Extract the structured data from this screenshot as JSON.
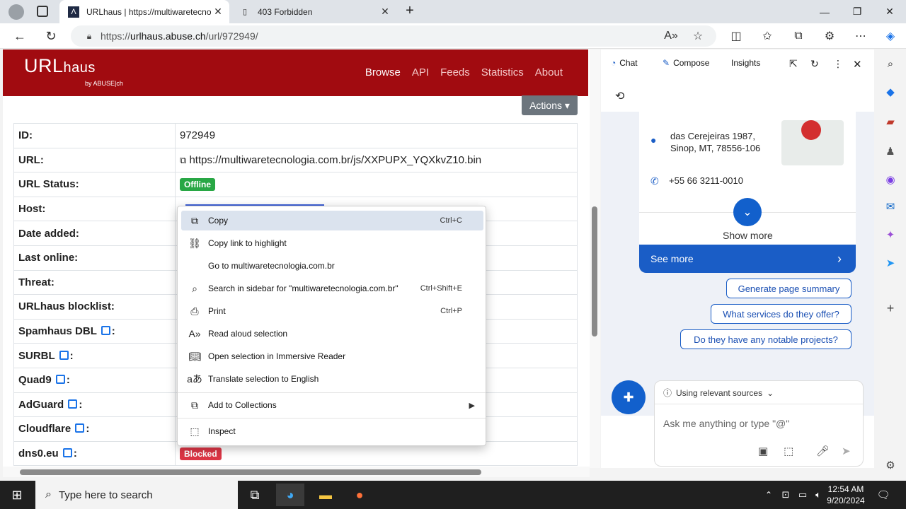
{
  "browser": {
    "tabs": [
      {
        "title": "URLhaus | https://multiwaretecnologia",
        "icon": "urlhaus-favicon"
      },
      {
        "title": "403 Forbidden",
        "icon": "page-icon"
      }
    ],
    "address": {
      "prefix": "https://",
      "domain": "urlhaus.abuse.ch",
      "path": "/url/972949/"
    }
  },
  "site": {
    "logo_main": "URL",
    "logo_sub": "haus",
    "logo_by": "by ABUSE|ch",
    "nav": [
      "Browse",
      "API",
      "Feeds",
      "Statistics",
      "About"
    ],
    "actions_label": "Actions ▾"
  },
  "table": [
    {
      "key": "ID:",
      "value": "972949"
    },
    {
      "key": "URL:",
      "value": "https://multiwaretecnologia.com.br/js/XXPUPX_YQXkvZ10.bin"
    },
    {
      "key": "URL Status:",
      "value": "Offline"
    },
    {
      "key": "Host:",
      "value": ""
    },
    {
      "key": "Date added:",
      "value": ""
    },
    {
      "key": "Last online:",
      "value": ""
    },
    {
      "key": "Threat:",
      "value": ""
    },
    {
      "key": "URLhaus blocklist:",
      "value": ""
    },
    {
      "key": "Spamhaus DBL",
      "value": ""
    },
    {
      "key": "SURBL",
      "value": ""
    },
    {
      "key": "Quad9",
      "value": ""
    },
    {
      "key": "AdGuard",
      "value": ""
    },
    {
      "key": "Cloudflare",
      "value": ""
    },
    {
      "key": "dns0.eu",
      "value": "Blocked"
    }
  ],
  "status_colors": {
    "offline": "#28a745",
    "blocked": "#dc3545",
    "brand": "#a10b10"
  },
  "context_menu": [
    {
      "label": "Copy",
      "shortcut": "Ctrl+C",
      "icon": "copy-icon"
    },
    {
      "label": "Copy link to highlight",
      "shortcut": "",
      "icon": "link-icon"
    },
    {
      "label": "Go to multiwaretecnologia.com.br",
      "shortcut": "",
      "icon": ""
    },
    {
      "label": "Search in sidebar for \"multiwaretecnologia.com.br\"",
      "shortcut": "Ctrl+Shift+E",
      "icon": "sidebar-search-icon"
    },
    {
      "label": "Print",
      "shortcut": "Ctrl+P",
      "icon": "print-icon"
    },
    {
      "label": "Read aloud selection",
      "shortcut": "",
      "icon": "read-aloud-icon"
    },
    {
      "label": "Open selection in Immersive Reader",
      "shortcut": "",
      "icon": "immersive-reader-icon"
    },
    {
      "label": "Translate selection to English",
      "shortcut": "",
      "icon": "translate-icon"
    },
    {
      "label": "Add to Collections",
      "shortcut": "",
      "icon": "collections-icon"
    },
    {
      "label": "Inspect",
      "shortcut": "",
      "icon": "inspect-icon"
    }
  ],
  "sidebar": {
    "tabs": [
      "Chat",
      "Compose",
      "Insights"
    ],
    "address_line1": "das Cerejeiras 1987,",
    "address_line2": "Sinop, MT, 78556-106",
    "phone": "+55 66 3211-0010",
    "show_more": "Show more",
    "see_more": "See more",
    "suggestions": [
      "Generate page summary",
      "What services do they offer?",
      "Do they have any notable projects?"
    ],
    "sources_label": "Using relevant sources",
    "input_placeholder": "Ask me anything or type \"@\""
  },
  "taskbar": {
    "search_placeholder": "Type here to search",
    "time": "12:54 AM",
    "date": "9/20/2024"
  }
}
